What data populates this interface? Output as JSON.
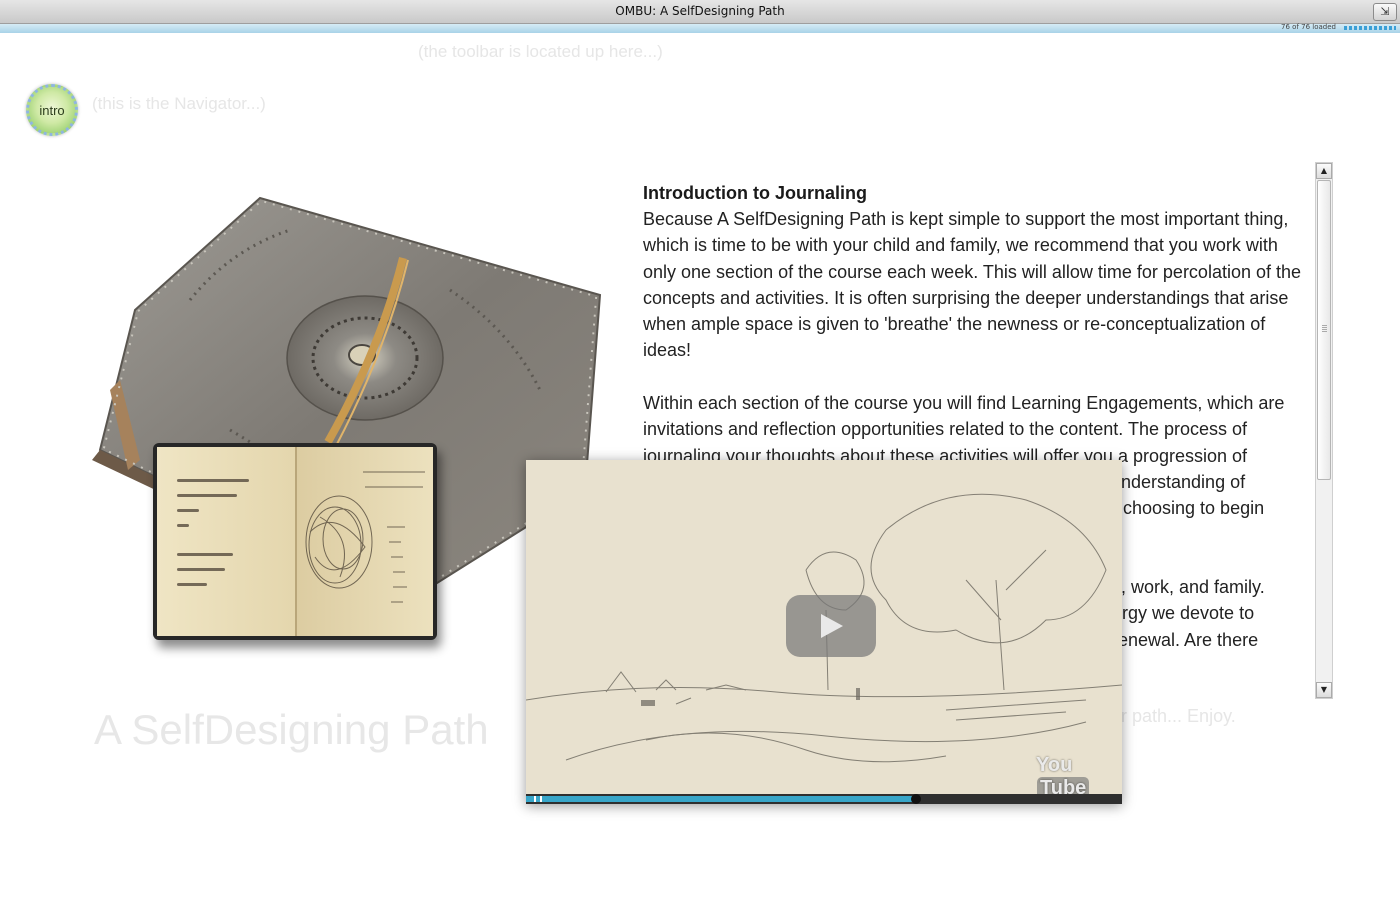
{
  "window": {
    "title": "OMBU: A SelfDesigning Path",
    "fullscreen_glyph": "⇲"
  },
  "loading": {
    "status": "76 of 76 loaded",
    "progress": 1.0
  },
  "hints": {
    "toolbar": "(the toolbar is located up here...)",
    "navigator": "(this is the Navigator...)",
    "enjoy": "your path... Enjoy."
  },
  "navigator": {
    "label": "intro"
  },
  "page_title": "A SelfDesigning Path",
  "article": {
    "heading": "Introduction to Journaling",
    "paragraph1": "Because A SelfDesigning Path is kept simple to support the most important thing, which is time to be with your child and family, we recommend that you work with only one section of the course each week. This will allow time for percolation of the concepts and activities. It is often surprising the deeper understandings that arise when ample space is given to 'breathe' the newness or re-conceptualization of ideas!",
    "paragraph2": "Within each section of the course you will find Learning Engagements, which are invitations and reflection opportunities related to the content. The process of journaling your thoughts about these activities will offer you a progression of",
    "partial_lines": [
      "nderstanding of",
      "r choosing to begin",
      "s, work, and family.",
      "ergy we devote to",
      "renewal. Are there"
    ]
  },
  "scrollbar": {
    "up": "▲",
    "down": "▼",
    "position": 0.0
  },
  "video": {
    "logo_you": "You",
    "logo_tube": "Tube",
    "progress": 0.655,
    "accent": "#38a6c9"
  }
}
